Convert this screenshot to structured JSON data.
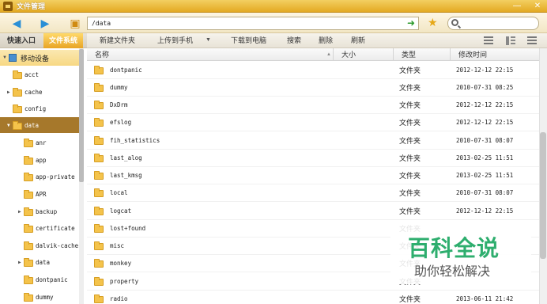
{
  "window": {
    "title": "文件管理",
    "minimize_icon": "minimize-icon",
    "close_icon": "close-icon"
  },
  "address": {
    "path": "/data"
  },
  "tabs": {
    "quick_access": "快速入口",
    "file_system": "文件系统"
  },
  "toolbar": {
    "new_folder": "新建文件夹",
    "upload": "上传到手机",
    "download": "下载到电脑",
    "search": "搜索",
    "delete": "删除",
    "refresh": "刷新"
  },
  "sidebar": {
    "device": "移动设备",
    "items": [
      {
        "label": "acct",
        "expandable": false
      },
      {
        "label": "cache",
        "expandable": true
      },
      {
        "label": "config",
        "expandable": false
      },
      {
        "label": "data",
        "expandable": true,
        "selected": true
      },
      {
        "label": "anr",
        "expandable": false
      },
      {
        "label": "app",
        "expandable": false
      },
      {
        "label": "app-private",
        "expandable": false
      },
      {
        "label": "APR",
        "expandable": false
      },
      {
        "label": "backup",
        "expandable": true
      },
      {
        "label": "certificate",
        "expandable": false
      },
      {
        "label": "dalvik-cache",
        "expandable": false
      },
      {
        "label": "data",
        "expandable": true
      },
      {
        "label": "dontpanic",
        "expandable": false
      },
      {
        "label": "dummy",
        "expandable": false
      }
    ]
  },
  "columns": {
    "name": "名称",
    "size": "大小",
    "type": "类型",
    "modified": "修改时间"
  },
  "files": [
    {
      "name": "dontpanic",
      "type": "文件夹",
      "modified": "2012-12-12 22:15"
    },
    {
      "name": "dummy",
      "type": "文件夹",
      "modified": "2010-07-31 08:25"
    },
    {
      "name": "DxDrm",
      "type": "文件夹",
      "modified": "2012-12-12 22:15"
    },
    {
      "name": "efslog",
      "type": "文件夹",
      "modified": "2012-12-12 22:15"
    },
    {
      "name": "fih_statistics",
      "type": "文件夹",
      "modified": "2010-07-31 08:07"
    },
    {
      "name": "last_alog",
      "type": "文件夹",
      "modified": "2013-02-25 11:51"
    },
    {
      "name": "last_kmsg",
      "type": "文件夹",
      "modified": "2013-02-25 11:51"
    },
    {
      "name": "local",
      "type": "文件夹",
      "modified": "2010-07-31 08:07"
    },
    {
      "name": "logcat",
      "type": "文件夹",
      "modified": "2012-12-12 22:15"
    },
    {
      "name": "lost+found",
      "type": "文件夹",
      "modified": ""
    },
    {
      "name": "misc",
      "type": "文件夹",
      "modified": ""
    },
    {
      "name": "monkey",
      "type": "文件夹",
      "modified": ""
    },
    {
      "name": "property",
      "type": "文件夹",
      "modified": ""
    },
    {
      "name": "radio",
      "type": "文件夹",
      "modified": "2013-06-11 21:42"
    }
  ],
  "watermark": {
    "big": "百科全说",
    "small": "助你轻松解决"
  }
}
